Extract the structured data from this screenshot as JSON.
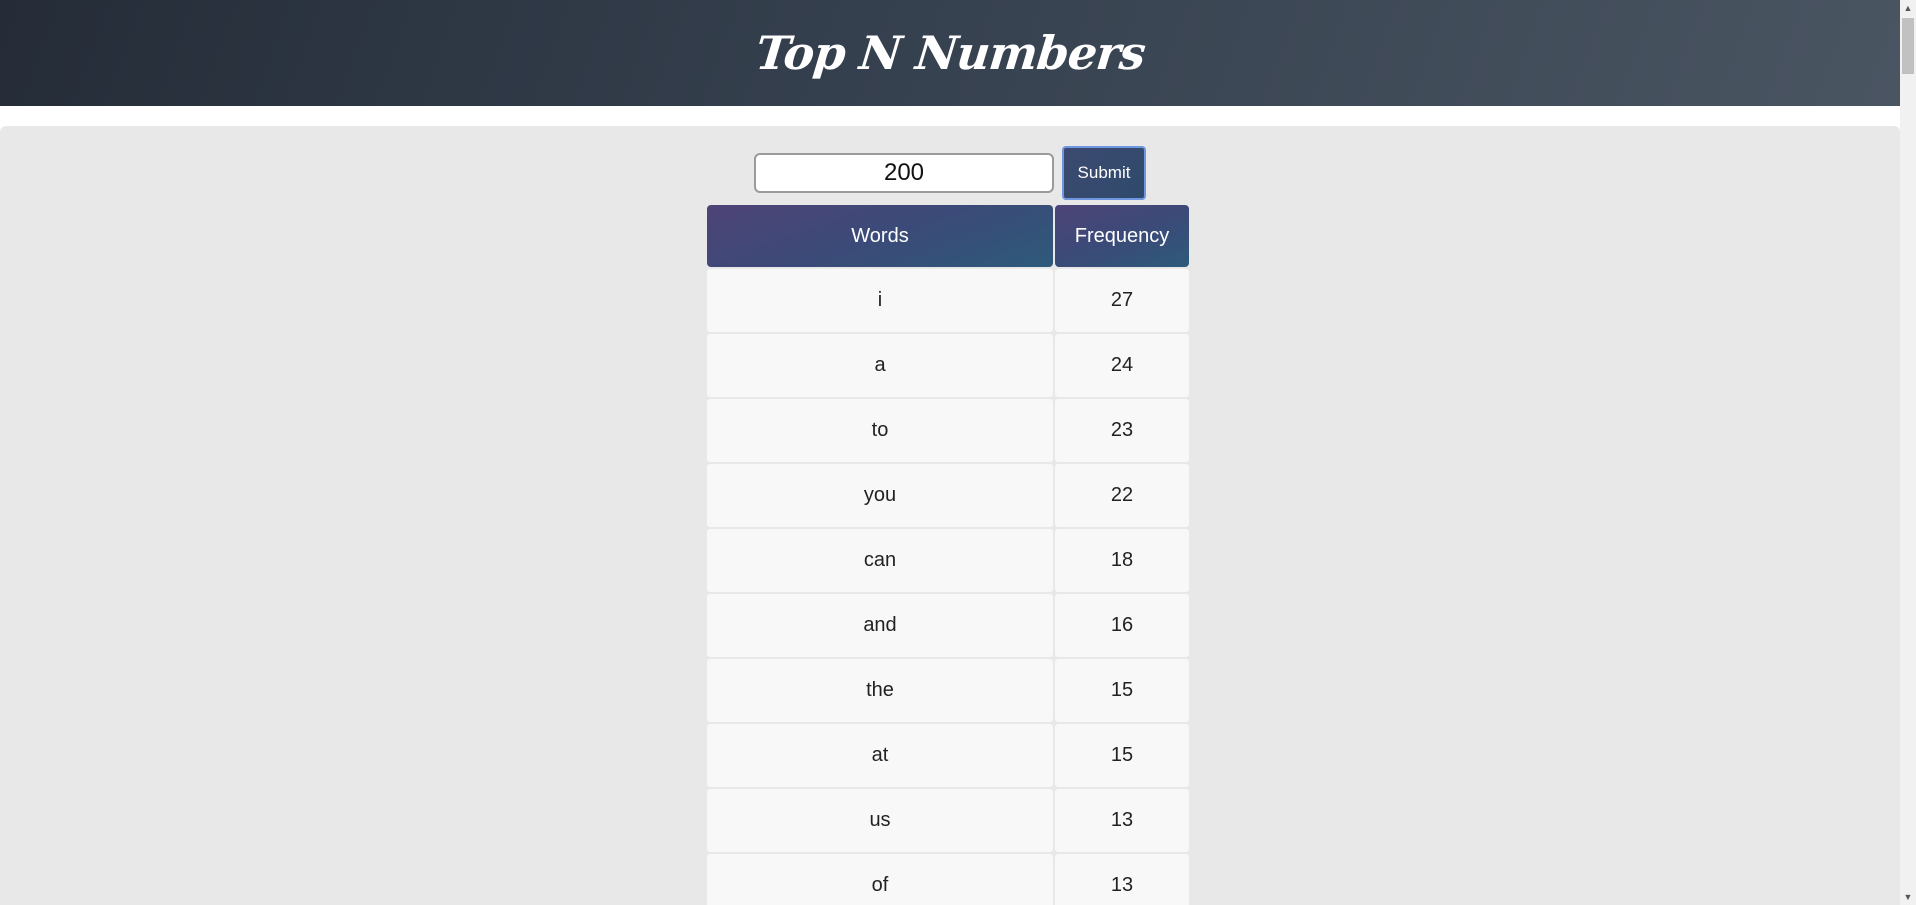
{
  "header": {
    "title": "Top N Numbers"
  },
  "controls": {
    "input_value": "200",
    "submit_label": "Submit"
  },
  "table": {
    "columns": [
      "Words",
      "Frequency"
    ],
    "rows": [
      {
        "word": "i",
        "freq": "27"
      },
      {
        "word": "a",
        "freq": "24"
      },
      {
        "word": "to",
        "freq": "23"
      },
      {
        "word": "you",
        "freq": "22"
      },
      {
        "word": "can",
        "freq": "18"
      },
      {
        "word": "and",
        "freq": "16"
      },
      {
        "word": "the",
        "freq": "15"
      },
      {
        "word": "at",
        "freq": "15"
      },
      {
        "word": "us",
        "freq": "13"
      },
      {
        "word": "of",
        "freq": "13"
      }
    ]
  },
  "scrollbar": {
    "up_icon": "triangle-up-icon",
    "down_icon": "triangle-down-icon"
  },
  "colors": {
    "header_bg": "#2f3845",
    "main_bg": "#e8e8e8",
    "table_header_bg": "#413f6d",
    "button_bg": "#34496e",
    "cell_bg": "#f8f8f8"
  }
}
